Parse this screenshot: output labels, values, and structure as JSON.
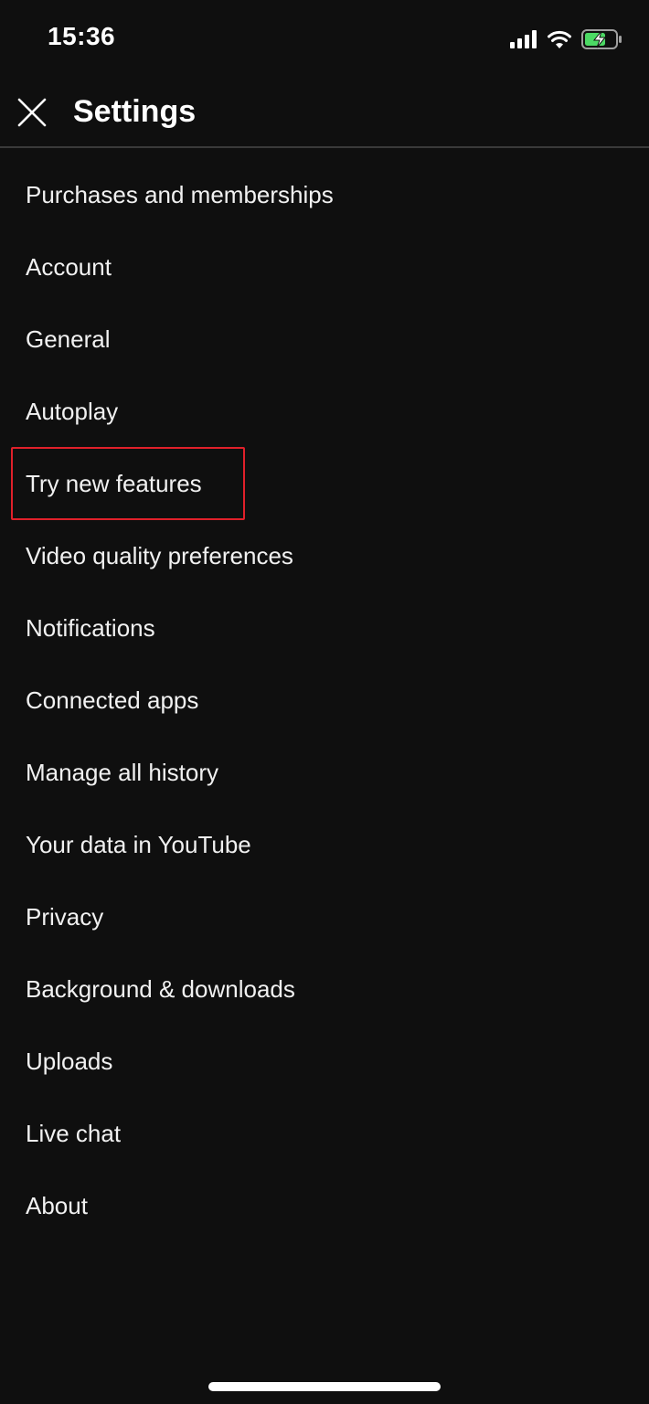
{
  "status_bar": {
    "time": "15:36",
    "signal_icon": "cellular-signal-icon",
    "wifi_icon": "wifi-icon",
    "battery_icon": "battery-charging-icon",
    "battery_color": "#4cd964"
  },
  "header": {
    "close_icon": "close-icon",
    "title": "Settings"
  },
  "menu": {
    "items": [
      {
        "label": "Purchases and memberships"
      },
      {
        "label": "Account"
      },
      {
        "label": "General"
      },
      {
        "label": "Autoplay"
      },
      {
        "label": "Try new features"
      },
      {
        "label": "Video quality preferences"
      },
      {
        "label": "Notifications"
      },
      {
        "label": "Connected apps"
      },
      {
        "label": "Manage all history"
      },
      {
        "label": "Your data in YouTube"
      },
      {
        "label": "Privacy"
      },
      {
        "label": "Background & downloads"
      },
      {
        "label": "Uploads"
      },
      {
        "label": "Live chat"
      },
      {
        "label": "About"
      }
    ]
  },
  "highlight": {
    "target": "Try new features",
    "color": "#e0202a"
  },
  "colors": {
    "background": "#0f0f0f",
    "text": "#f1f1f1",
    "divider": "#3a3a3a"
  }
}
